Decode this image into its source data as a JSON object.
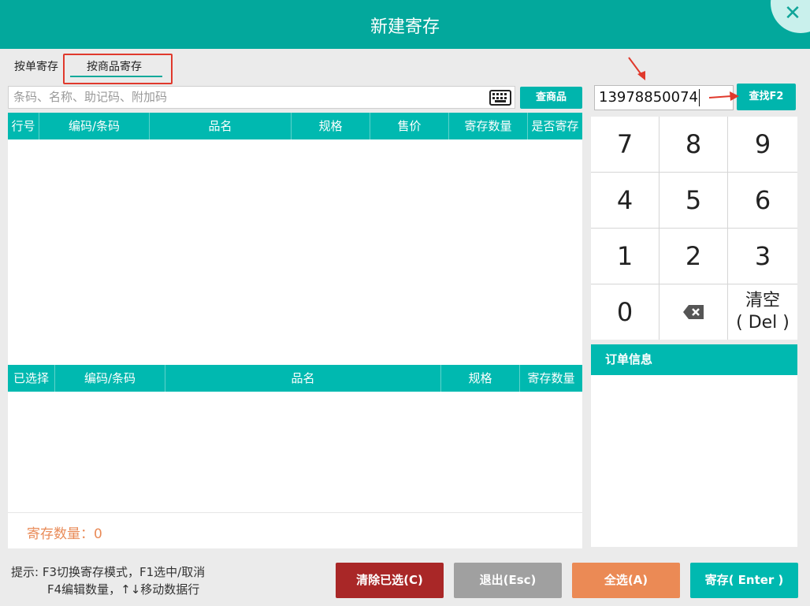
{
  "window": {
    "title": "新建寄存",
    "close_glyph": "✕"
  },
  "tabs": [
    {
      "label": "按单寄存"
    },
    {
      "label": "按商品寄存",
      "active": true
    }
  ],
  "search": {
    "placeholder": "条码、名称、助记码、附加码",
    "button": "查商品"
  },
  "product_table": {
    "columns": [
      "行号",
      "编码/条码",
      "品名",
      "规格",
      "售价",
      "寄存数量",
      "是否寄存"
    ],
    "rows": []
  },
  "selected_table": {
    "columns": [
      "已选择",
      "编码/条码",
      "品名",
      "规格",
      "寄存数量"
    ],
    "rows": []
  },
  "summary": {
    "label": "寄存数量：",
    "value": "0"
  },
  "member": {
    "value": "13978850074",
    "find_button": "查找F2"
  },
  "keypad": {
    "keys": [
      "7",
      "8",
      "9",
      "4",
      "5",
      "6",
      "1",
      "2",
      "3",
      "0"
    ],
    "backspace_icon": "backspace-icon",
    "clear_line1": "清空",
    "clear_line2": "( Del )"
  },
  "order": {
    "title": "订单信息"
  },
  "hint": {
    "line1": "提示: F3切换寄存模式，F1选中/取消",
    "line2": "F4编辑数量，↑↓移动数据行"
  },
  "buttons": {
    "clear": "清除已选(C)",
    "exit": "退出(Esc)",
    "select_all": "全选(A)",
    "save": "寄存( Enter )"
  },
  "colors": {
    "accent": "#00b9b0",
    "title_bar": "#03a89c",
    "danger": "#a92727",
    "warning": "#eb8a55",
    "annotation": "#e0392c"
  }
}
